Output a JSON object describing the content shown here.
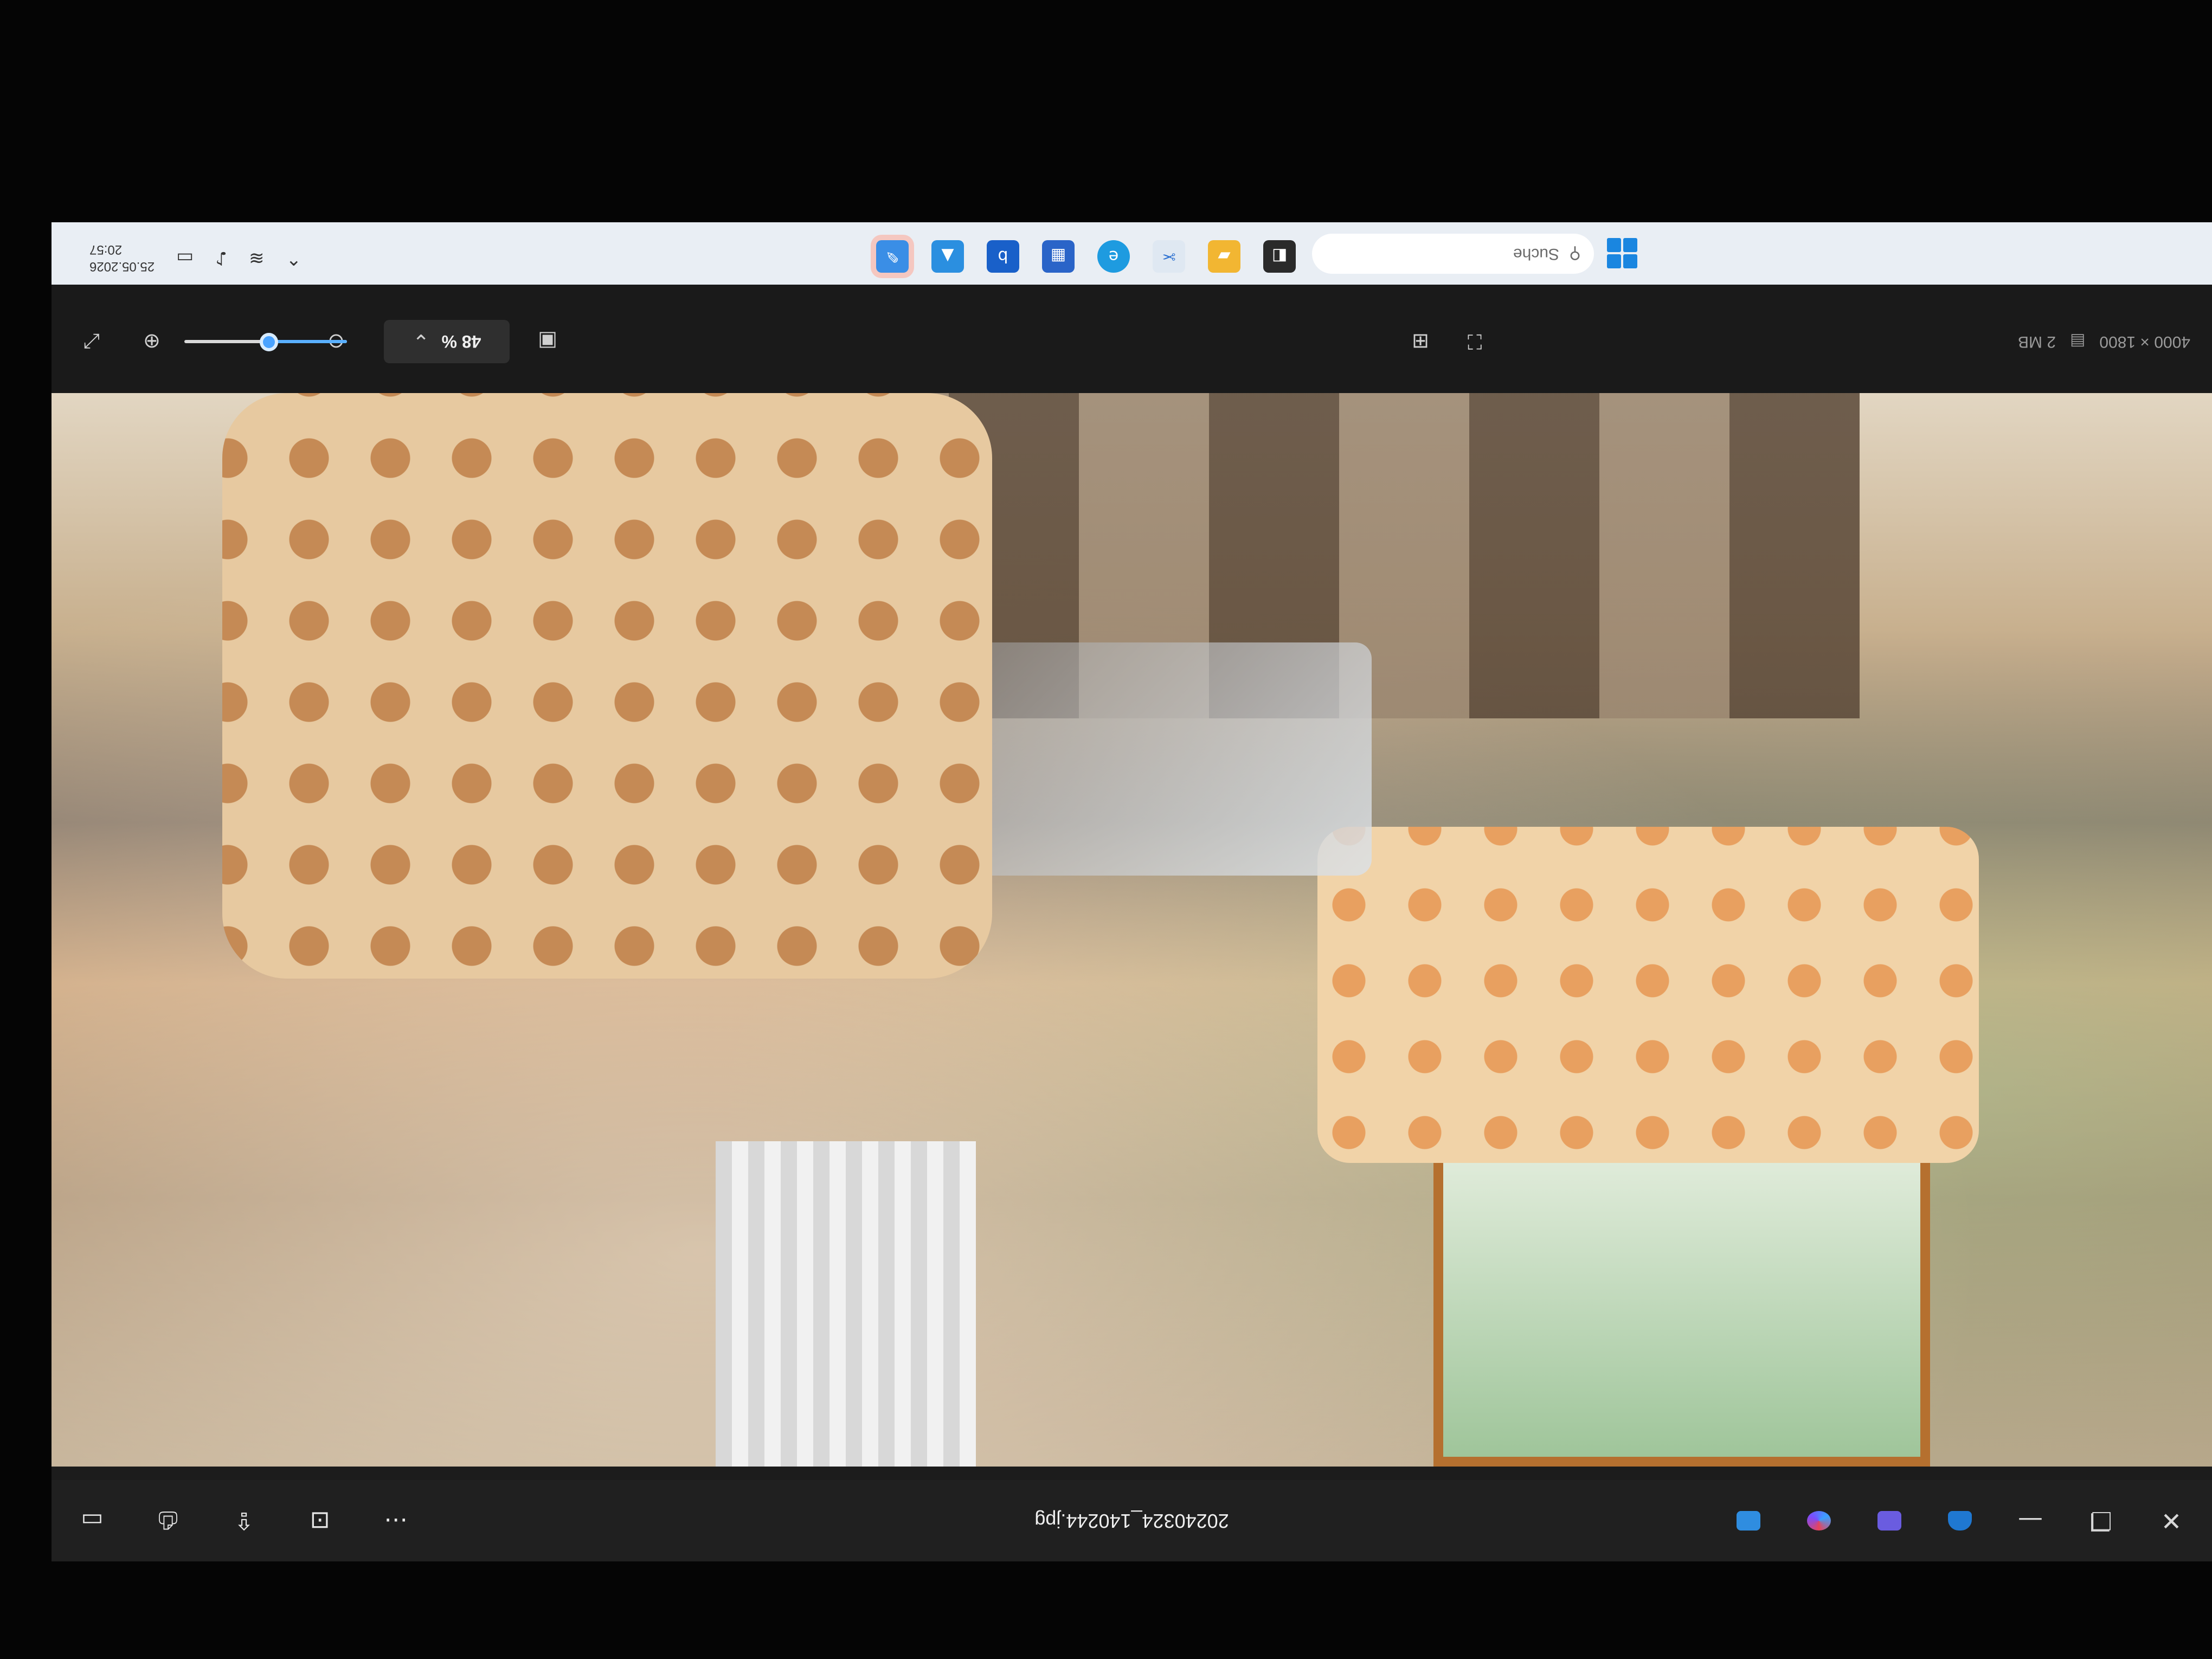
{
  "app": {
    "file_name": "20240324_140244.jpg",
    "window_controls": {
      "minimize": "—",
      "restore": "❐",
      "close": "✕"
    },
    "title_tools": [
      "edit-icon",
      "draw-icon",
      "gallery-icon",
      "onedrive-icon"
    ],
    "title_actions": [
      "print-icon",
      "share-icon",
      "info-icon",
      "more-icon"
    ]
  },
  "toolbar": {
    "zoom_label": "48 %",
    "zoom_fraction": 0.48,
    "image_info": "4000 × 1800",
    "file_size": "2 MB"
  },
  "taskbar": {
    "search_placeholder": "Suche",
    "apps": [
      "file-explorer-icon",
      "snipping-icon",
      "edge-icon",
      "store-icon",
      "bing-icon",
      "photos-icon",
      "photos-active-icon"
    ],
    "clock_time": "20:57",
    "clock_date": "25.05.2026"
  }
}
